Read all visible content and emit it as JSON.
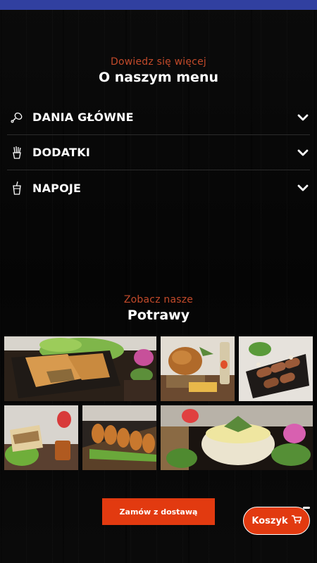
{
  "colors": {
    "accent": "#e23a10",
    "subheading": "#c24a2a",
    "status_bar": "#3140a0",
    "background": "#080808"
  },
  "menu_section": {
    "subtitle": "Dowiedz się więcej",
    "title": "O naszym menu",
    "items": [
      {
        "label": "DANIA GŁÓWNE",
        "icon": "drumstick-icon",
        "expand_icon": "chevron-down-icon"
      },
      {
        "label": "DODATKI",
        "icon": "fries-icon",
        "expand_icon": "chevron-down-icon"
      },
      {
        "label": "NAPOJE",
        "icon": "drink-cup-icon",
        "expand_icon": "chevron-down-icon"
      }
    ]
  },
  "dishes_section": {
    "subtitle": "Zobacz nasze",
    "title": "Potrawy",
    "photos": [
      {
        "subject": "tortilla wraps with lettuce and flowers"
      },
      {
        "subject": "roasted chicken with fries and herbs"
      },
      {
        "subject": "rolled crepes with sesame and strawberry leaves"
      },
      {
        "subject": "sandwich wraps with lettuce and sauce jar"
      },
      {
        "subject": "skewered rolls on a wooden board"
      },
      {
        "subject": "mashed potatoes in a pot with dill"
      }
    ]
  },
  "order_button": {
    "label": "Zamów z dostawą"
  },
  "cart_button": {
    "label": "Koszyk",
    "icon": "cart-icon"
  }
}
